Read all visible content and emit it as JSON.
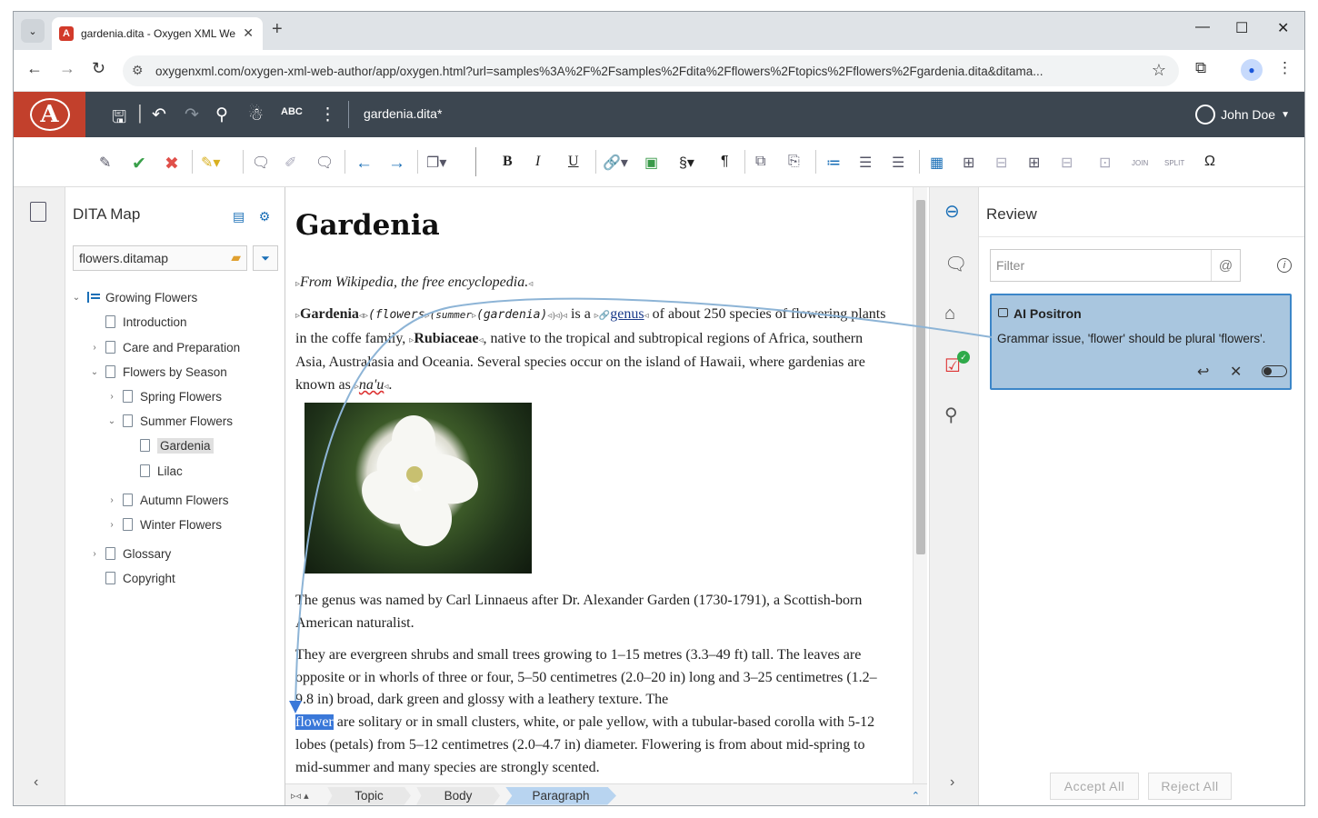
{
  "browser": {
    "tab_title": "gardenia.dita - Oxygen XML We",
    "url": "oxygenxml.com/oxygen-xml-web-author/app/oxygen.html?url=samples%3A%2F%2Fsamples%2Fdita%2Fflowers%2Ftopics%2Fflowers%2Fgardenia.dita&ditama..."
  },
  "header": {
    "doc_name": "gardenia.dita*",
    "user": "John Doe"
  },
  "map_panel": {
    "title": "DITA Map",
    "map_file": "flowers.ditamap",
    "tree": [
      {
        "label": "Growing Flowers"
      },
      {
        "label": "Introduction"
      },
      {
        "label": "Care and Preparation"
      },
      {
        "label": "Flowers by Season"
      },
      {
        "label": "Spring Flowers"
      },
      {
        "label": "Summer Flowers"
      },
      {
        "label": "Gardenia"
      },
      {
        "label": "Lilac"
      },
      {
        "label": "Autumn Flowers"
      },
      {
        "label": "Winter Flowers"
      },
      {
        "label": "Glossary"
      },
      {
        "label": "Copyright"
      }
    ]
  },
  "editor": {
    "title": "Gardenia",
    "source": "From Wikipedia, the free encyclopedia.",
    "p1_a": "Gardenia",
    "p1_b": "(flowers",
    "p1_c": "(summer",
    "p1_d": "(gardenia)",
    "p1_e": "is a",
    "p1_link": "genus",
    "p1_f": "of about 250 species of flowering plants in the coffe family,",
    "p1_g": "Rubiaceae",
    "p1_h": ", native to the tropical and subtropical regions of Africa, southern Asia, Australasia and Oceania. Several species occur on the island of Hawaii, where gardenias are known as",
    "p1_i": "na'u",
    "p2": "The genus was named by Carl Linnaeus after Dr. Alexander Garden (1730-1791), a Scottish-born American naturalist.",
    "p3_a": "They are evergreen shrubs and small trees growing to 1–15 metres (3.3–49 ft) tall. The leaves are opposite or in whorls of three or four, 5–50 centimetres (2.0–20 in) long and 3–25 centimetres (1.2–9.8 in) broad, dark green and glossy with a leathery texture. The",
    "p3_sel": "flower",
    "p3_b": "are solitary or in small clusters, white, or pale yellow, with a tubular-based corolla with 5-12 lobes (petals) from 5–12 centimetres (2.0–4.7 in) diameter. Flowering is from about mid-spring to mid-summer and many species are strongly scented."
  },
  "breadcrumb": [
    "Topic",
    "Body",
    "Paragraph"
  ],
  "review": {
    "title": "Review",
    "filter_placeholder": "Filter",
    "card_author": "AI Positron",
    "card_message": "Grammar issue, 'flower' should be plural 'flowers'.",
    "accept_all": "Accept All",
    "reject_all": "Reject All"
  },
  "colors": {
    "accent": "#c2402c",
    "header_bg": "#3c4650",
    "card_bg": "#a9c6df",
    "selection": "#3a78d9"
  }
}
